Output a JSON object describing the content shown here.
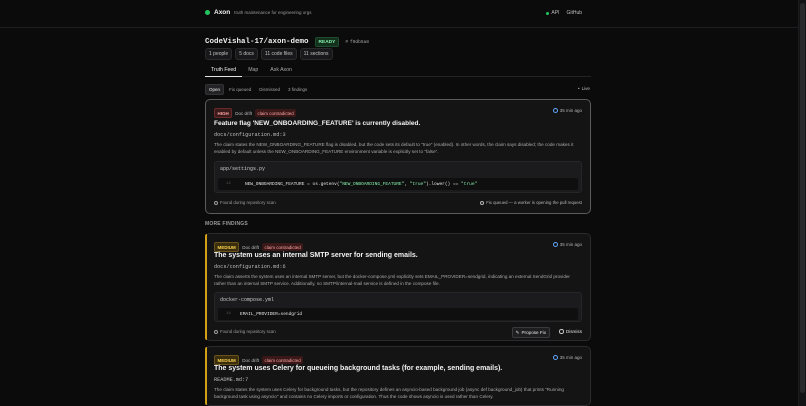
{
  "app": {
    "name": "Axon",
    "tagline": "truth maintenance for engineering orgs"
  },
  "topnav": {
    "api_label": "API",
    "github_label": "GitHub"
  },
  "repo": {
    "name": "CodeVishal-17/axon-demo",
    "status": "READY",
    "commit": "f0db5a8",
    "stats": [
      "1 people",
      "5 docs",
      "11 code files",
      "11 sections"
    ]
  },
  "tabs": [
    "Truth Feed",
    "Map",
    "Ask Axon"
  ],
  "filters": [
    "Open",
    "Fix queued",
    "Dismissed",
    "3 findings"
  ],
  "live_label": "Live",
  "hero": {
    "severity": "HIGH",
    "category": "Doc drift",
    "kind": "claim contradicted",
    "age": "35 min ago",
    "title": "Feature flag 'NEW_ONBOARDING_FEATURE' is currently disabled.",
    "path": "docs/configuration.md:3",
    "description": "The claim states the NEW_ONBOARDING_FEATURE flag is disabled, but the code sets its default to \"true\" (enabled). In other words, the claim says disabled; the code makes it enabled by default unless the NEW_ONBOARDING_FEATURE environment variable is explicitly set to \"false\".",
    "code_file": "app/settings.py",
    "code_line_no": "12",
    "code_pre": "NEW_ONBOARDING_FEATURE = os.getenv(",
    "code_str1": "\"NEW_ONBOARDING_FEATURE\"",
    "code_mid": ", ",
    "code_str2": "\"true\"",
    "code_post": ").lower() == ",
    "code_str3": "\"true\"",
    "found": "Found during repository scan",
    "status_note": "Fix queued — a worker is opening the pull request"
  },
  "more_label": "MORE FINDINGS",
  "findings": [
    {
      "severity": "MEDIUM",
      "category": "Doc drift",
      "kind": "claim contradicted",
      "age": "35 min ago",
      "title": "The system uses an internal SMTP server for sending emails.",
      "path": "docs/configuration.md:6",
      "description": "The claim asserts the system uses an internal SMTP server, but the docker-compose.yml explicitly sets EMAIL_PROVIDER=sendgrid, indicating an external SendGrid provider rather than an internal SMTP service. Additionally, no SMTP/internal-mail service is defined in the compose file.",
      "code_file": "docker-compose.yml",
      "code_line_no": "14",
      "code_text": "EMAIL_PROVIDER=sendgrid",
      "found": "Found during repository scan",
      "propose_label": "Propose Fix",
      "dismiss_label": "Dismiss"
    },
    {
      "severity": "MEDIUM",
      "category": "Doc drift",
      "kind": "claim contradicted",
      "age": "35 min ago",
      "title": "The system uses Celery for queueing background tasks (for example, sending emails).",
      "path": "README.md:7",
      "description": "The claim states the system uses Celery for background tasks, but the repository defines an asyncio-based background job (async def background_job) that prints \"Running background task using asyncio\" and contains no Celery imports or configuration. Thus the code shows asyncio is used rather than Celery."
    }
  ],
  "colors": {
    "accent": "#d4a017",
    "ok": "#22c55e",
    "danger": "#fca5a5"
  }
}
